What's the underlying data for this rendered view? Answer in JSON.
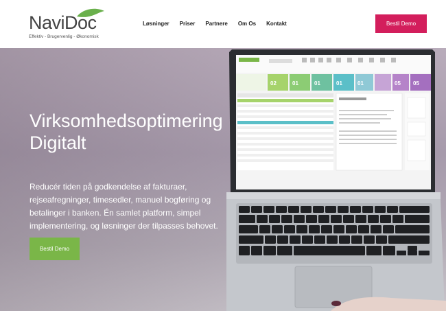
{
  "brand": {
    "name": "NaviDoc",
    "tagline": "Effektiv - Brugervenlig - Økonomisk",
    "leaf_color": "#6ab04c"
  },
  "nav": {
    "items": [
      "Løsninger",
      "Priser",
      "Partnere",
      "Om Os",
      "Kontakt"
    ],
    "cta_label": "Bestil Demo",
    "cta_color": "#d31e5c"
  },
  "hero": {
    "title": "Virksomhedsoptimering Digitalt",
    "text": "Reducér tiden på godkendelse af fakturaer, rejseafregninger, timesedler, manuel bogføring og betalinger i banken. Én samlet platform, simpel implementering, og løsninger der tilpasses behovet.",
    "cta_label": "Bestil Demo",
    "cta_color": "#7ab648"
  },
  "device": {
    "icon": "laptop-icon",
    "screen_tiles": [
      "02",
      "01",
      "01",
      "01",
      "01",
      "05",
      "05"
    ]
  }
}
